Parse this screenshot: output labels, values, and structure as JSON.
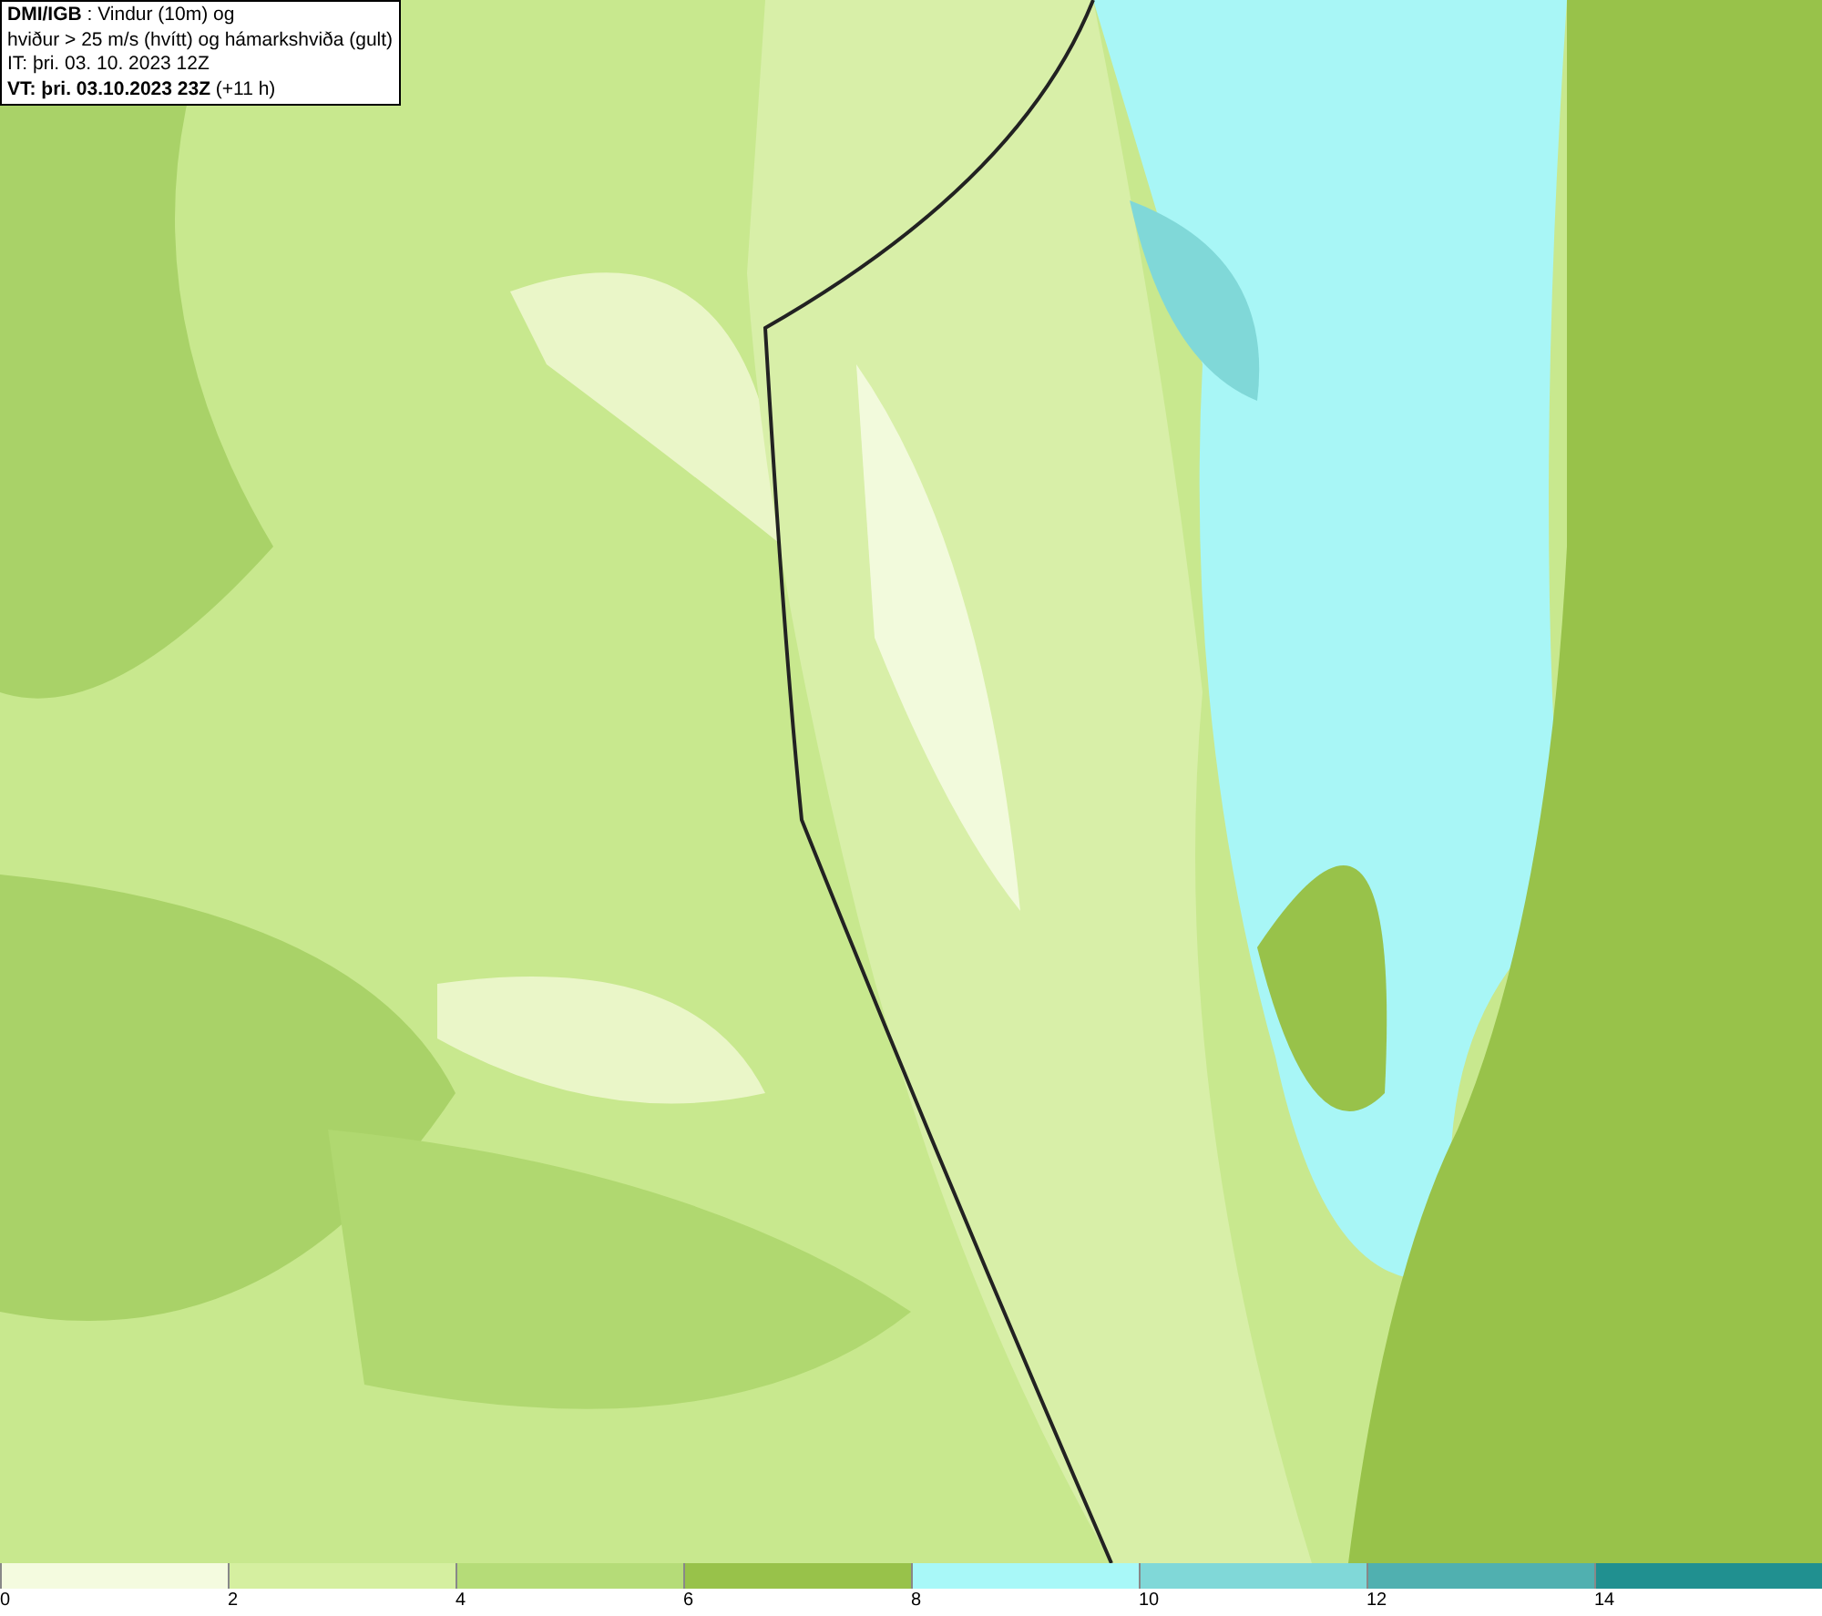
{
  "header": {
    "lines": [
      "**DMI/IGB** : Vindur (10m) og",
      "hviður > 25 m/s (hvítt) og hámarkshviða (gult)",
      "IT: þri. 03. 10. 2023 12Z",
      "**VT: þri. 03.10.2023 23Z** (+11 h)"
    ]
  },
  "legend": {
    "segments": [
      {
        "label": "0",
        "color": "#f4fbdf"
      },
      {
        "label": "2",
        "color": "#d5efa0"
      },
      {
        "label": "4",
        "color": "#b5dc78"
      },
      {
        "label": "6",
        "color": "#98c24a"
      },
      {
        "label": "8",
        "color": "#a8f8f8"
      },
      {
        "label": "10",
        "color": "#80d8d8"
      },
      {
        "label": "12",
        "color": "#50b0b0"
      },
      {
        "label": "14",
        "color": "#209090"
      }
    ]
  }
}
